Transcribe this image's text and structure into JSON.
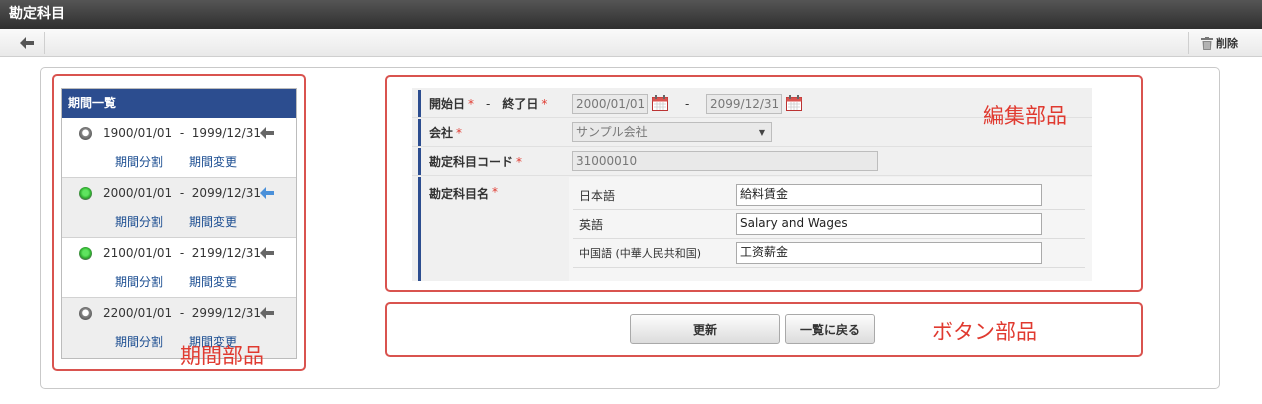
{
  "window": {
    "title": "勘定科目"
  },
  "toolbar": {
    "back_icon": "back-arrow-icon",
    "delete_label": "削除",
    "delete_icon": "trash-icon"
  },
  "period_panel": {
    "title": "期間一覧",
    "periods": [
      {
        "start": "1900/01/01",
        "sep": "-",
        "end": "1999/12/31",
        "selected": false,
        "current": false,
        "split_label": "期間分割",
        "change_label": "期間変更"
      },
      {
        "start": "2000/01/01",
        "sep": "-",
        "end": "2099/12/31",
        "selected": true,
        "current": true,
        "split_label": "期間分割",
        "change_label": "期間変更"
      },
      {
        "start": "2100/01/01",
        "sep": "-",
        "end": "2199/12/31",
        "selected": true,
        "current": false,
        "split_label": "期間分割",
        "change_label": "期間変更"
      },
      {
        "start": "2200/01/01",
        "sep": "-",
        "end": "2999/12/31",
        "selected": false,
        "current": false,
        "split_label": "期間分割",
        "change_label": "期間変更"
      }
    ]
  },
  "form": {
    "dates": {
      "start_label": "開始日",
      "end_label": "終了日",
      "label_sep": "-",
      "start_value": "2000/01/01",
      "range_sep": "-",
      "end_value": "2099/12/31"
    },
    "company": {
      "label": "会社",
      "value": "サンプル会社"
    },
    "code": {
      "label": "勘定科目コード",
      "value": "31000010"
    },
    "name": {
      "label": "勘定科目名",
      "langs": [
        {
          "label": "日本語",
          "value": "給料賃金"
        },
        {
          "label": "英語",
          "value": "Salary and Wages"
        },
        {
          "label": "中国語 (中華人民共和国)",
          "value": "工资薪金"
        }
      ]
    },
    "required_mark": "*"
  },
  "buttons": {
    "update": "更新",
    "back_to_list": "一覧に戻る"
  },
  "annotations": {
    "edit_part": "編集部品",
    "button_part": "ボタン部品",
    "period_part": "期間部品"
  },
  "colors": {
    "panel_header": "#2c4d8f",
    "annotation": "#e03a30",
    "link": "#1a4c90"
  }
}
